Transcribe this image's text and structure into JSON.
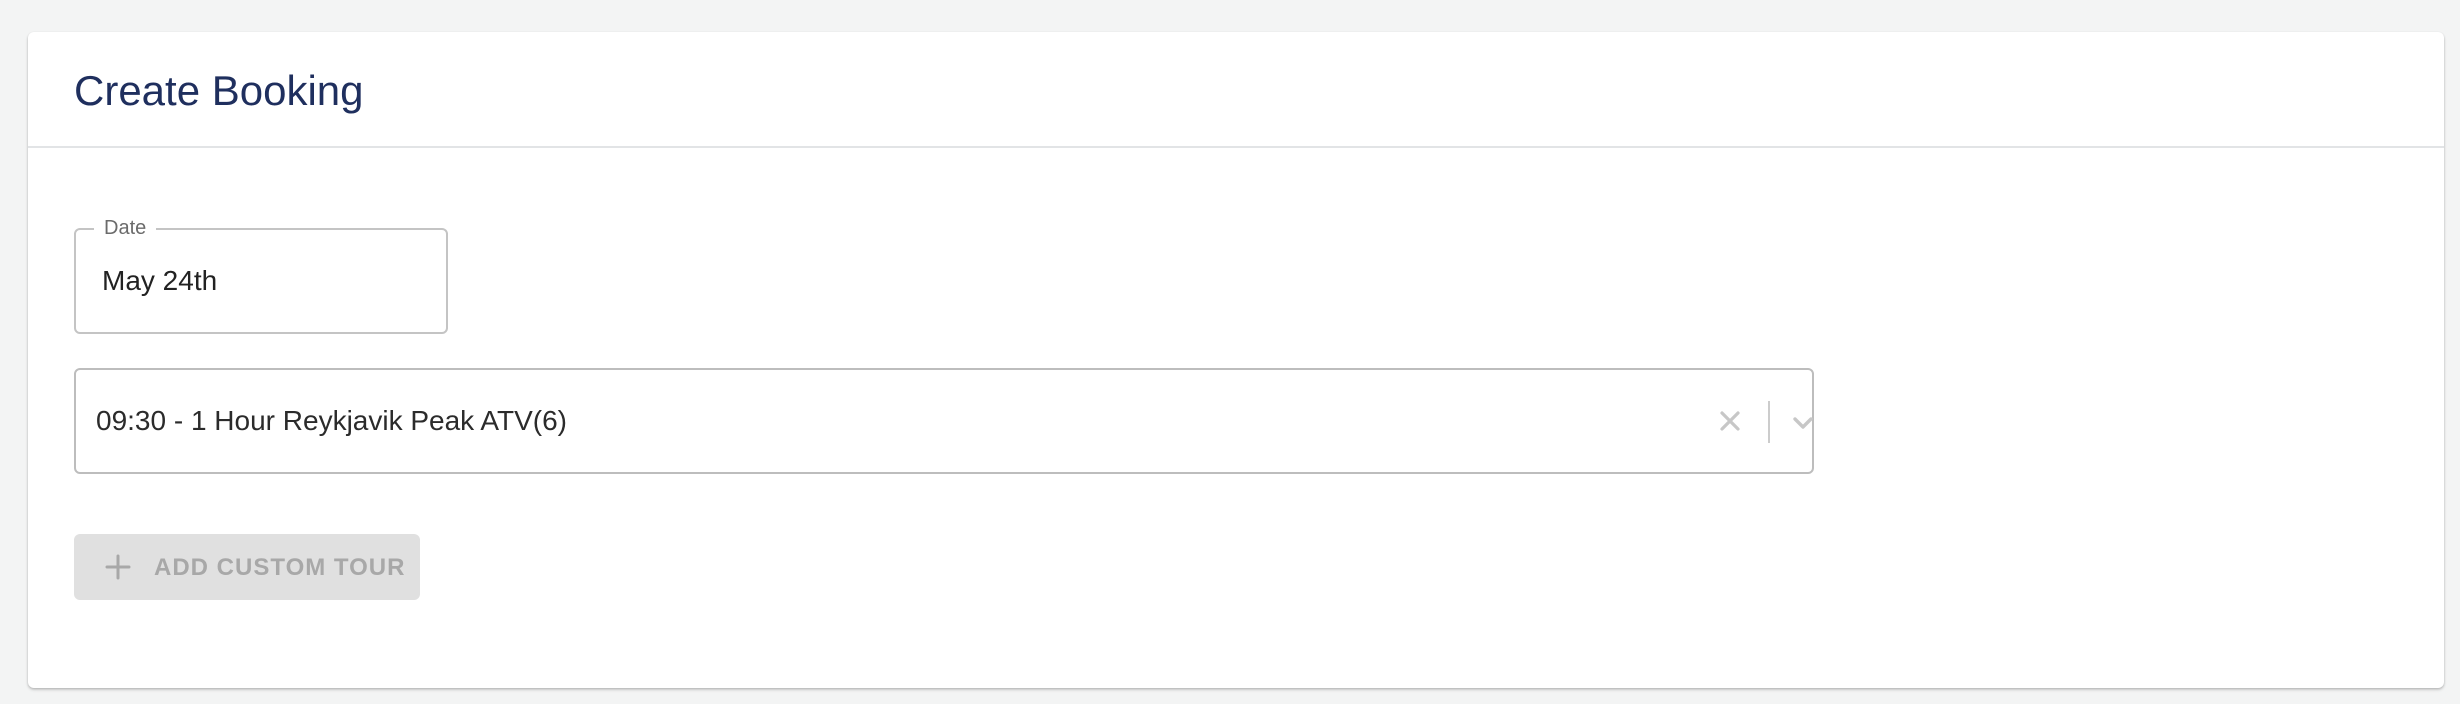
{
  "page": {
    "title": "Create Booking"
  },
  "date_field": {
    "label": "Date",
    "value": "May 24th"
  },
  "tour_select": {
    "value": "09:30 - 1 Hour Reykjavik Peak ATV(6)",
    "clear_icon": "close-icon",
    "dropdown_icon": "chevron-down-icon"
  },
  "add_custom_tour": {
    "label": "ADD CUSTOM TOUR",
    "icon": "plus-icon",
    "disabled": true
  },
  "colors": {
    "title": "#1f2f5e",
    "background": "#f3f4f4",
    "button_disabled_bg": "#e0e0e0",
    "button_disabled_text": "#a8a8a8"
  }
}
